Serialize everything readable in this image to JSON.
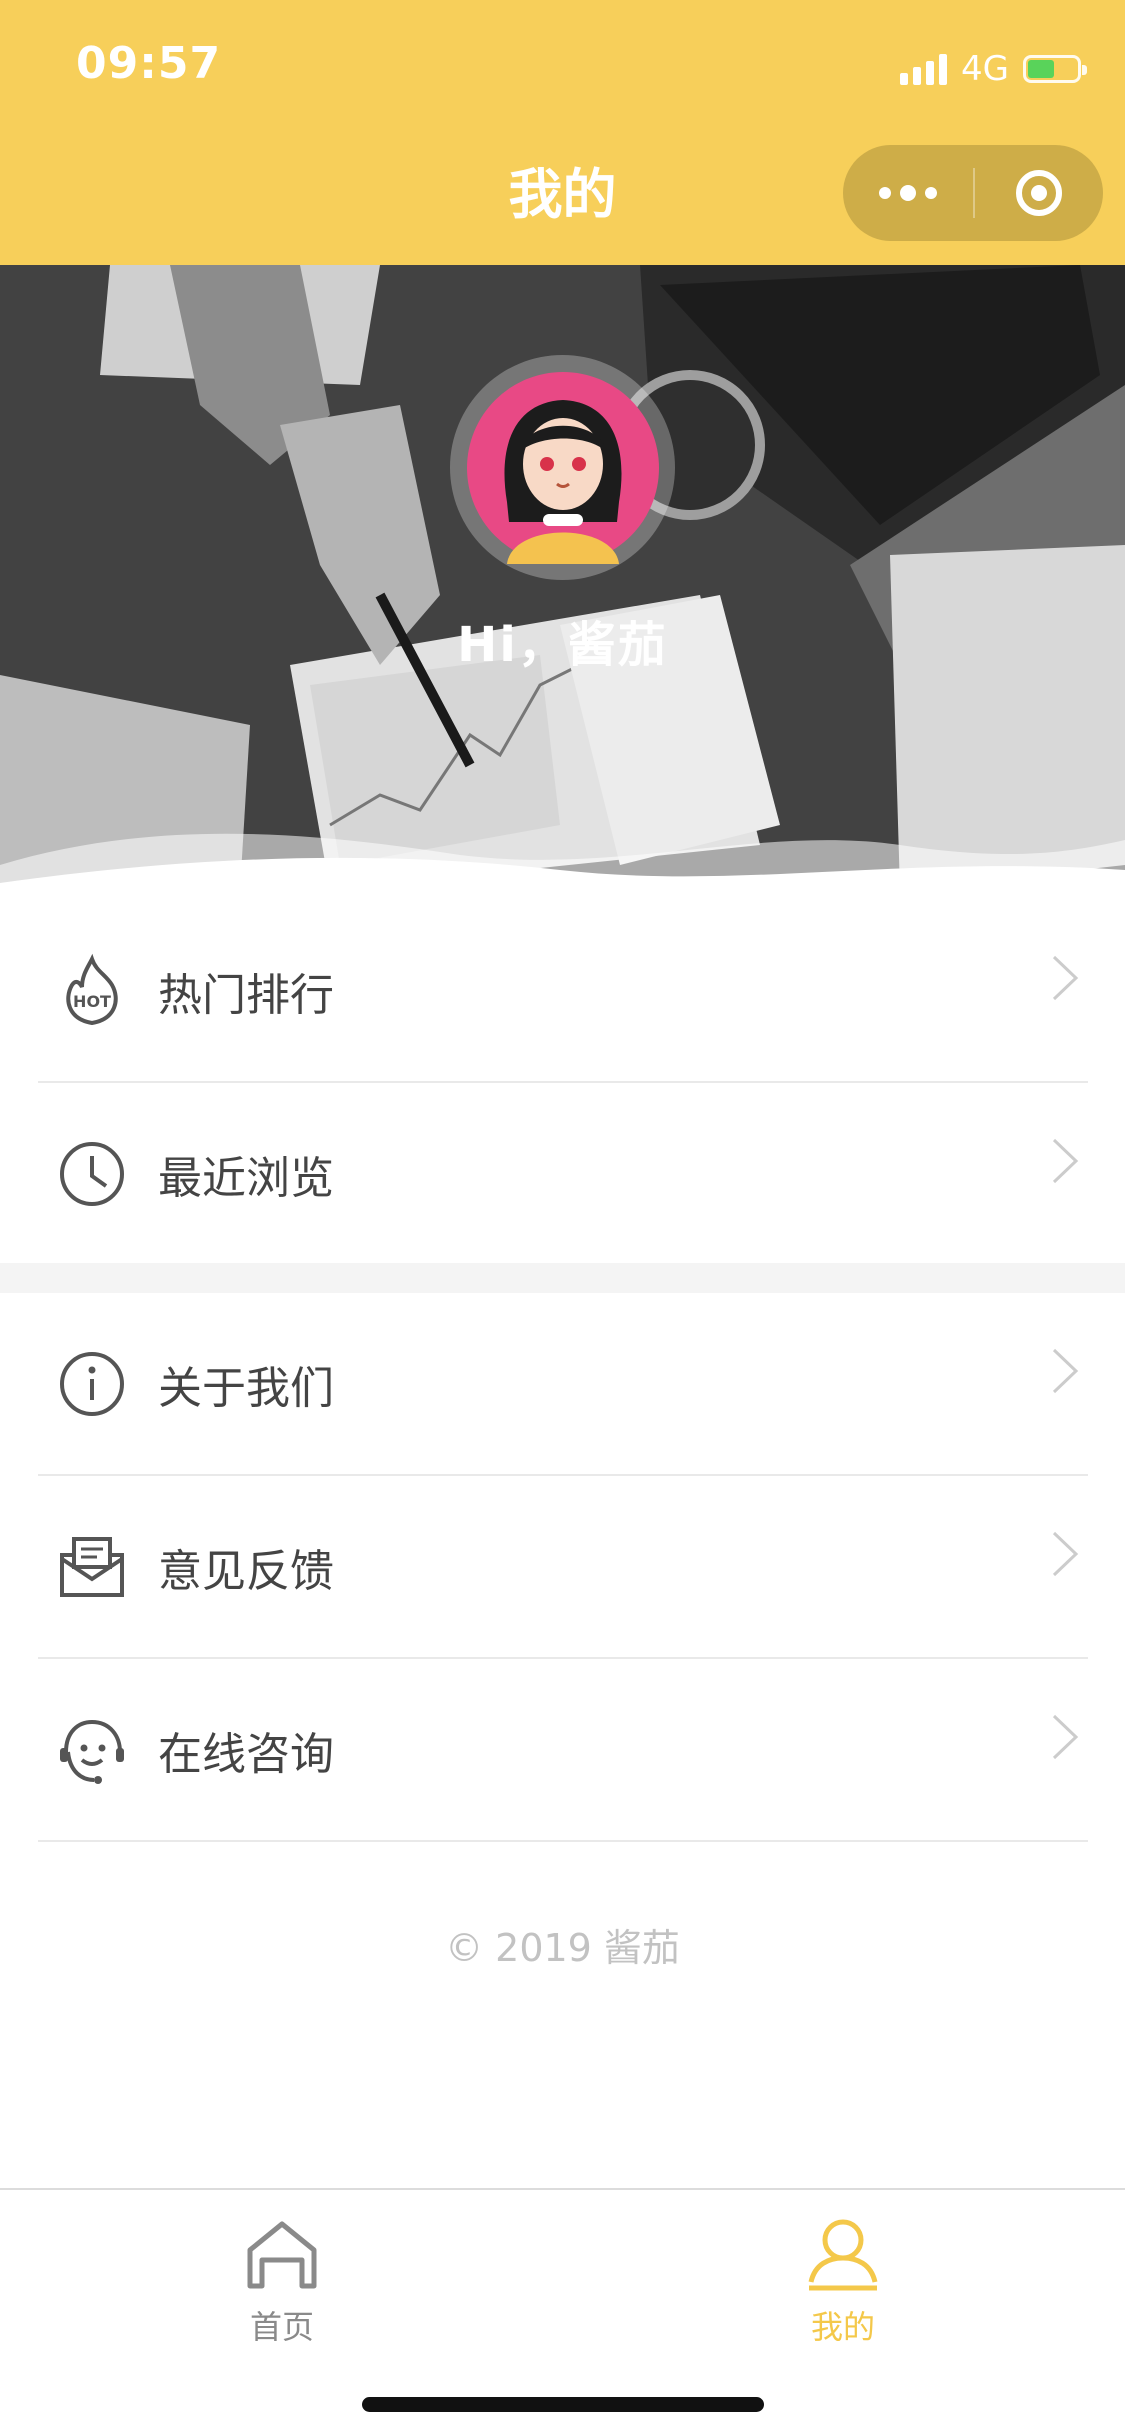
{
  "status_bar": {
    "time": "09:57",
    "network": "4G"
  },
  "header": {
    "title": "我的",
    "background_color": "#f7cf5a"
  },
  "profile": {
    "greeting": "Hi，酱茄"
  },
  "menu": {
    "group1": [
      {
        "label": "热门排行",
        "icon": "hot-icon"
      },
      {
        "label": "最近浏览",
        "icon": "clock-icon"
      }
    ],
    "group2": [
      {
        "label": "关于我们",
        "icon": "info-icon"
      },
      {
        "label": "意见反馈",
        "icon": "mail-icon"
      },
      {
        "label": "在线咨询",
        "icon": "support-icon"
      }
    ]
  },
  "footer": {
    "copyright": "© 2019 酱茄"
  },
  "tabbar": {
    "items": [
      {
        "label": "首页",
        "icon": "home-icon",
        "active": false
      },
      {
        "label": "我的",
        "icon": "user-icon",
        "active": true
      }
    ],
    "active_color": "#f4c84a",
    "inactive_color": "#8a8a8a"
  }
}
